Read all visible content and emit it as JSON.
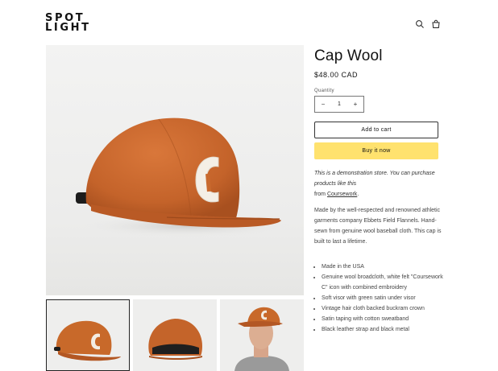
{
  "header": {
    "logo_line1": "SPOT",
    "logo_line2": "LIGHT",
    "search_icon": "search-icon",
    "cart_icon": "cart-icon"
  },
  "gallery": {
    "main_image": "orange wool cap with white felt C patch",
    "thumbnails": [
      "cap front view",
      "cap back view",
      "man wearing cap"
    ]
  },
  "product": {
    "title": "Cap Wool",
    "price": "$48.00 CAD",
    "quantity_label": "Quantity",
    "quantity_value": "1",
    "decrease_symbol": "−",
    "increase_symbol": "+",
    "add_to_cart": "Add to cart",
    "buy_now": "Buy it now",
    "demo_text_1": "This is a demonstration store. You can purchase products like this",
    "demo_text_2": "from ",
    "demo_link": "Coursework",
    "demo_text_3": ".",
    "description": "Made by the well-respected and renowned athletic garments company Ebbets Field Flannels. Hand-sewn from genuine wool baseball cloth. This cap is built to last a lifetime.",
    "features": [
      "Made in the USA",
      "Genuine wool broadcloth, white felt \"Coursework C\" icon  with combined embroidery",
      "Soft visor with green satin under visor",
      "Vintage hair cloth backed buckram crown",
      "Satin taping with cotton sweatband",
      "Black leather strap and black metal"
    ]
  },
  "colors": {
    "buy_button": "#ffe26e",
    "cap_orange": "#c8692a",
    "text": "#121212"
  }
}
